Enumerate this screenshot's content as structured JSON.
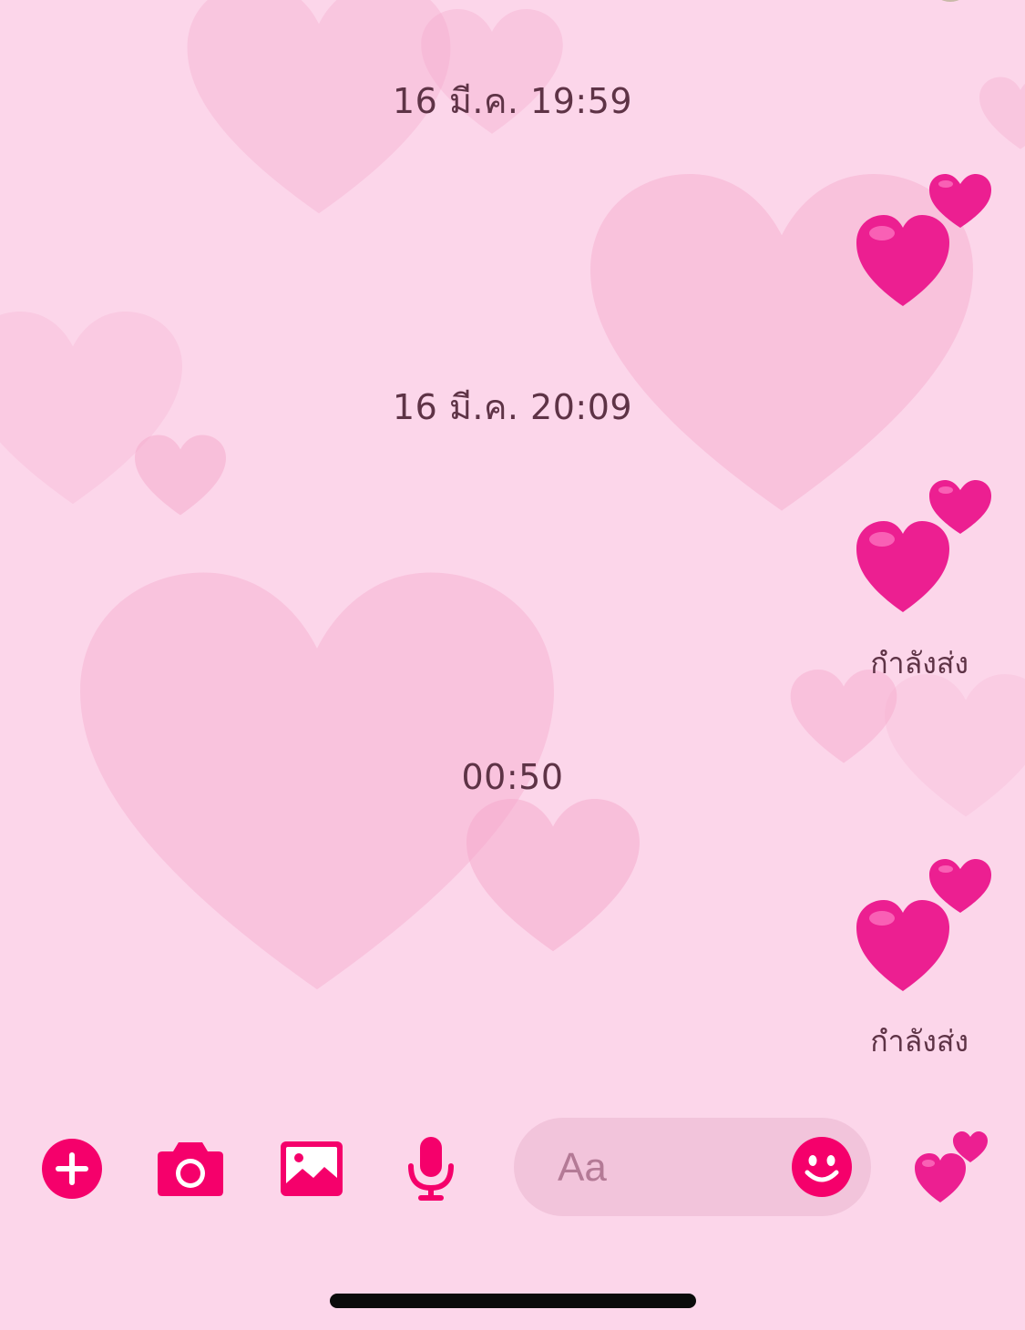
{
  "theme": {
    "background": "#fcd6ea",
    "accent": "#f5006b",
    "heart_emoji_color": "#ec1f91",
    "text_color": "#5e3346"
  },
  "messages": [
    {
      "type": "timestamp",
      "text": "16 มี.ค. 19:59"
    },
    {
      "type": "sticker",
      "emoji": "💞"
    },
    {
      "type": "timestamp",
      "text": "16 มี.ค. 20:09"
    },
    {
      "type": "sticker",
      "emoji": "💞",
      "status": "กำลังส่ง"
    },
    {
      "type": "timestamp",
      "text": "00:50"
    },
    {
      "type": "sticker",
      "emoji": "💞",
      "status": "กำลังส่ง"
    }
  ],
  "composer": {
    "placeholder": "Aa",
    "buttons": [
      "plus-icon",
      "camera-icon",
      "image-icon",
      "microphone-icon",
      "smiley-icon",
      "two-hearts-icon"
    ]
  }
}
